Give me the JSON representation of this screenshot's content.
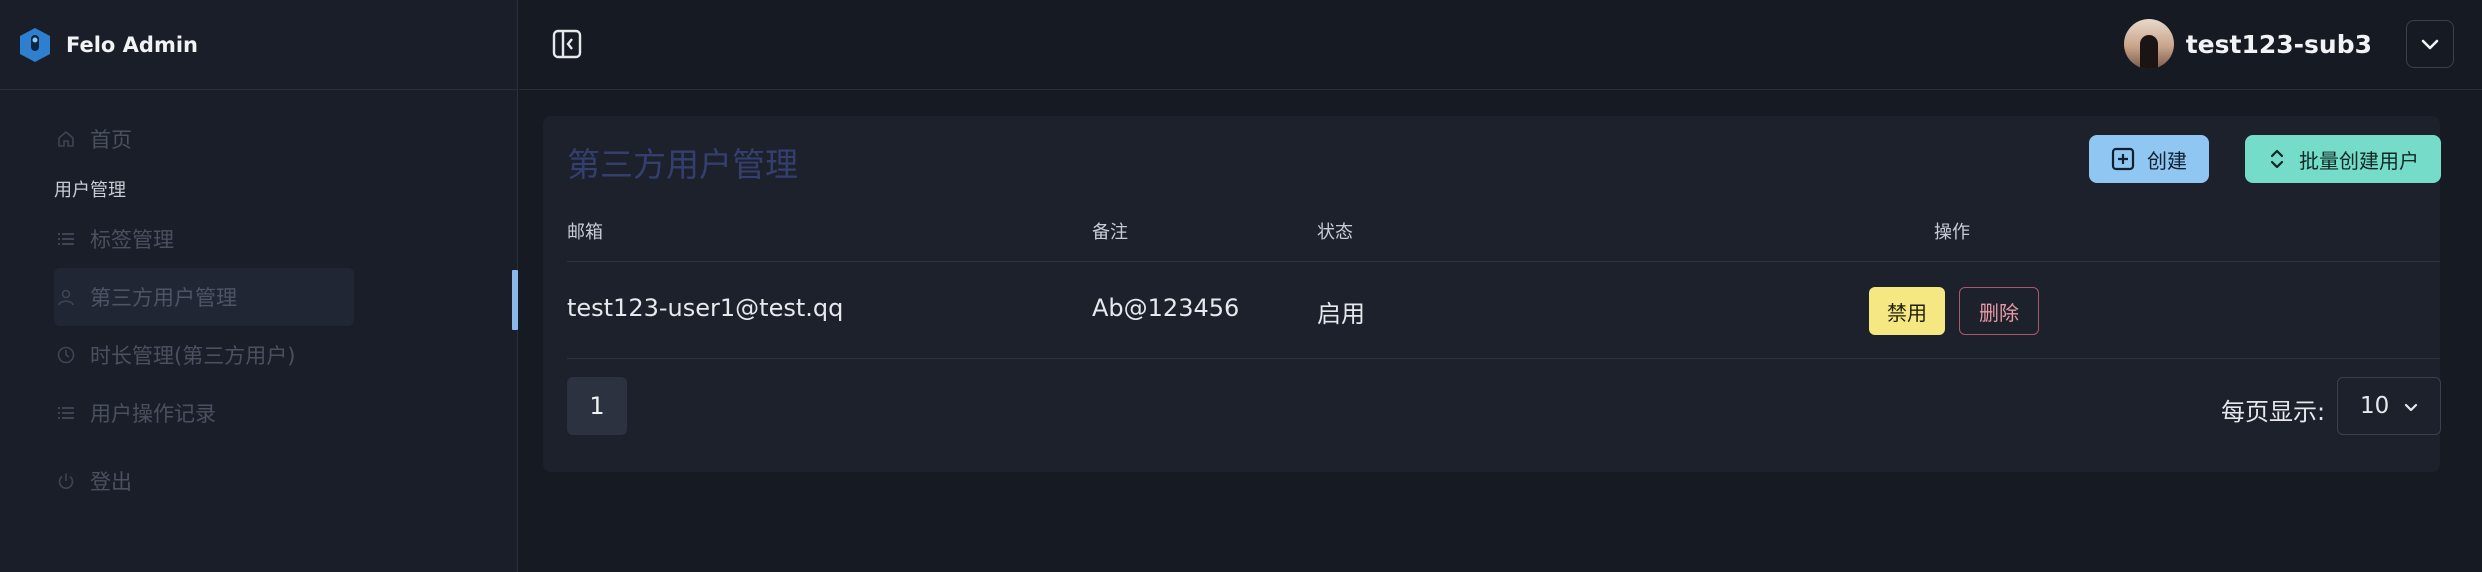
{
  "brand": {
    "name": "Felo Admin"
  },
  "sidebar": {
    "items": [
      {
        "label": "首页",
        "icon": "home-icon"
      },
      {
        "section": "用户管理"
      },
      {
        "label": "标签管理",
        "icon": "list-icon"
      },
      {
        "label": "第三方用户管理",
        "icon": "user-icon",
        "active": true
      },
      {
        "label": "时长管理(第三方用户)",
        "icon": "clock-icon"
      },
      {
        "label": "用户操作记录",
        "icon": "list-icon"
      },
      {
        "label": "登出",
        "icon": "power-icon"
      }
    ]
  },
  "header": {
    "username": "test123-sub3"
  },
  "page": {
    "title": "第三方用户管理",
    "create_label": "创建",
    "batch_create_label": "批量创建用户"
  },
  "table": {
    "columns": [
      "邮箱",
      "备注",
      "状态",
      "操作"
    ],
    "rows": [
      {
        "email": "test123-user1@test.qq",
        "note": "Ab@123456",
        "status": "启用",
        "disable_label": "禁用",
        "delete_label": "删除"
      }
    ]
  },
  "pagination": {
    "current_page": "1",
    "per_page_label": "每页显示:",
    "per_page_value": "10"
  },
  "colors": {
    "accent_blue": "#8fc6f2",
    "accent_teal": "#74dcc8",
    "disable_yellow": "#f5e782",
    "delete_red": "#e79aa6"
  }
}
